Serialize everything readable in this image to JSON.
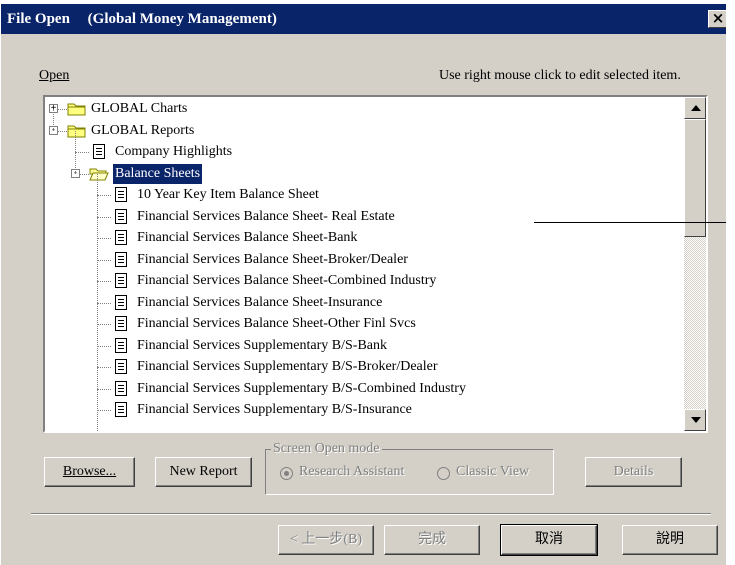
{
  "window": {
    "title": "File Open",
    "subtitle": "(Global Money Management)",
    "close_glyph": "×"
  },
  "header": {
    "open_label": "Open",
    "hint": "Use right mouse click to edit selected item."
  },
  "tree": {
    "items": [
      {
        "label": "GLOBAL Charts",
        "type": "folder",
        "level": 0,
        "expander": "+"
      },
      {
        "label": "GLOBAL Reports",
        "type": "folder",
        "level": 0,
        "expander": "−"
      },
      {
        "label": "Company Highlights",
        "type": "doc",
        "level": 1
      },
      {
        "label": "Balance Sheets",
        "type": "folder-open",
        "level": 1,
        "expander": "−",
        "selected": true
      },
      {
        "label": "10 Year Key Item Balance Sheet",
        "type": "doc",
        "level": 2
      },
      {
        "label": "Financial Services Balance Sheet- Real Estate",
        "type": "doc",
        "level": 2
      },
      {
        "label": "Financial Services Balance Sheet-Bank",
        "type": "doc",
        "level": 2
      },
      {
        "label": "Financial Services Balance Sheet-Broker/Dealer",
        "type": "doc",
        "level": 2
      },
      {
        "label": "Financial Services Balance Sheet-Combined Industry",
        "type": "doc",
        "level": 2
      },
      {
        "label": "Financial Services Balance Sheet-Insurance",
        "type": "doc",
        "level": 2
      },
      {
        "label": "Financial Services Balance Sheet-Other Finl Svcs",
        "type": "doc",
        "level": 2
      },
      {
        "label": "Financial Services Supplementary B/S-Bank",
        "type": "doc",
        "level": 2
      },
      {
        "label": "Financial Services Supplementary B/S-Broker/Dealer",
        "type": "doc",
        "level": 2
      },
      {
        "label": "Financial Services Supplementary B/S-Combined Industry",
        "type": "doc",
        "level": 2
      },
      {
        "label": "Financial Services Supplementary B/S-Insurance",
        "type": "doc",
        "level": 2
      }
    ]
  },
  "buttons": {
    "browse": "Browse...",
    "new_report": "New Report",
    "details": "Details",
    "back": "< 上一步(B)",
    "finish": "完成",
    "cancel": "取消",
    "help": "說明"
  },
  "screen_mode": {
    "title": "Screen Open mode",
    "options": [
      "Research Assistant",
      "Classic View"
    ],
    "selected": "Research Assistant"
  },
  "colors": {
    "titlebar": "#0a246a",
    "face": "#d4d0c8",
    "selection": "#0a246a"
  }
}
